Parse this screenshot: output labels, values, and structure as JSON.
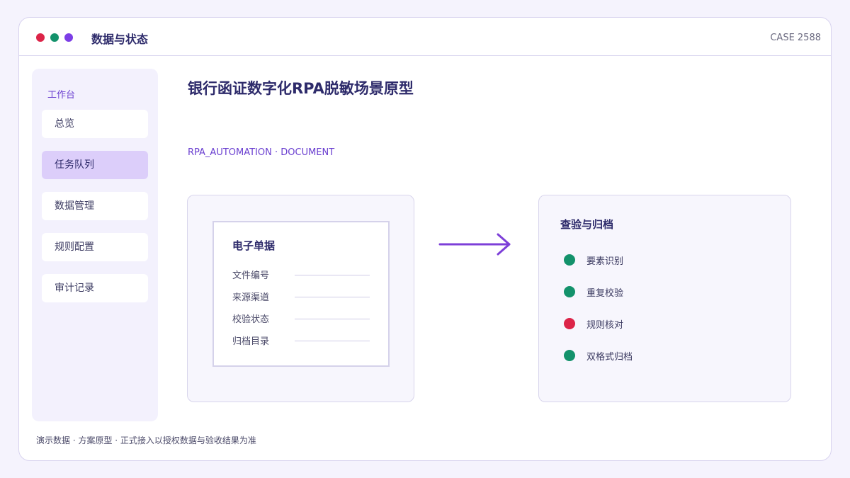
{
  "colors": {
    "accent": "#6a3fd0",
    "dot_red": "#dc2448",
    "dot_green": "#13926b",
    "dot_purple": "#7c3ee6",
    "status_ok": "#13926b",
    "status_error": "#dc2448",
    "arrow": "#7d3fd8"
  },
  "window": {
    "title": "数据与状态",
    "case_label": "CASE 2588"
  },
  "sidebar": {
    "header": "工作台",
    "items": [
      {
        "label": "总览",
        "active": false
      },
      {
        "label": "任务队列",
        "active": true
      },
      {
        "label": "数据管理",
        "active": false
      },
      {
        "label": "规则配置",
        "active": false
      },
      {
        "label": "审计记录",
        "active": false
      }
    ]
  },
  "main": {
    "title": "银行函证数字化RPA脱敏场景原型",
    "subtitle": "RPA_AUTOMATION · DOCUMENT",
    "doc_card": {
      "title": "电子单据",
      "fields": [
        "文件编号",
        "来源渠道",
        "校验状态",
        "归档目录"
      ]
    },
    "arrow_icon": "arrow-right-icon",
    "check_card": {
      "title": "查验与归档",
      "items": [
        {
          "label": "要素识别",
          "status": "ok"
        },
        {
          "label": "重复校验",
          "status": "ok"
        },
        {
          "label": "规则核对",
          "status": "error"
        },
        {
          "label": "双格式归档",
          "status": "ok"
        }
      ]
    }
  },
  "footer": "演示数据 · 方案原型 · 正式接入以授权数据与验收结果为准"
}
